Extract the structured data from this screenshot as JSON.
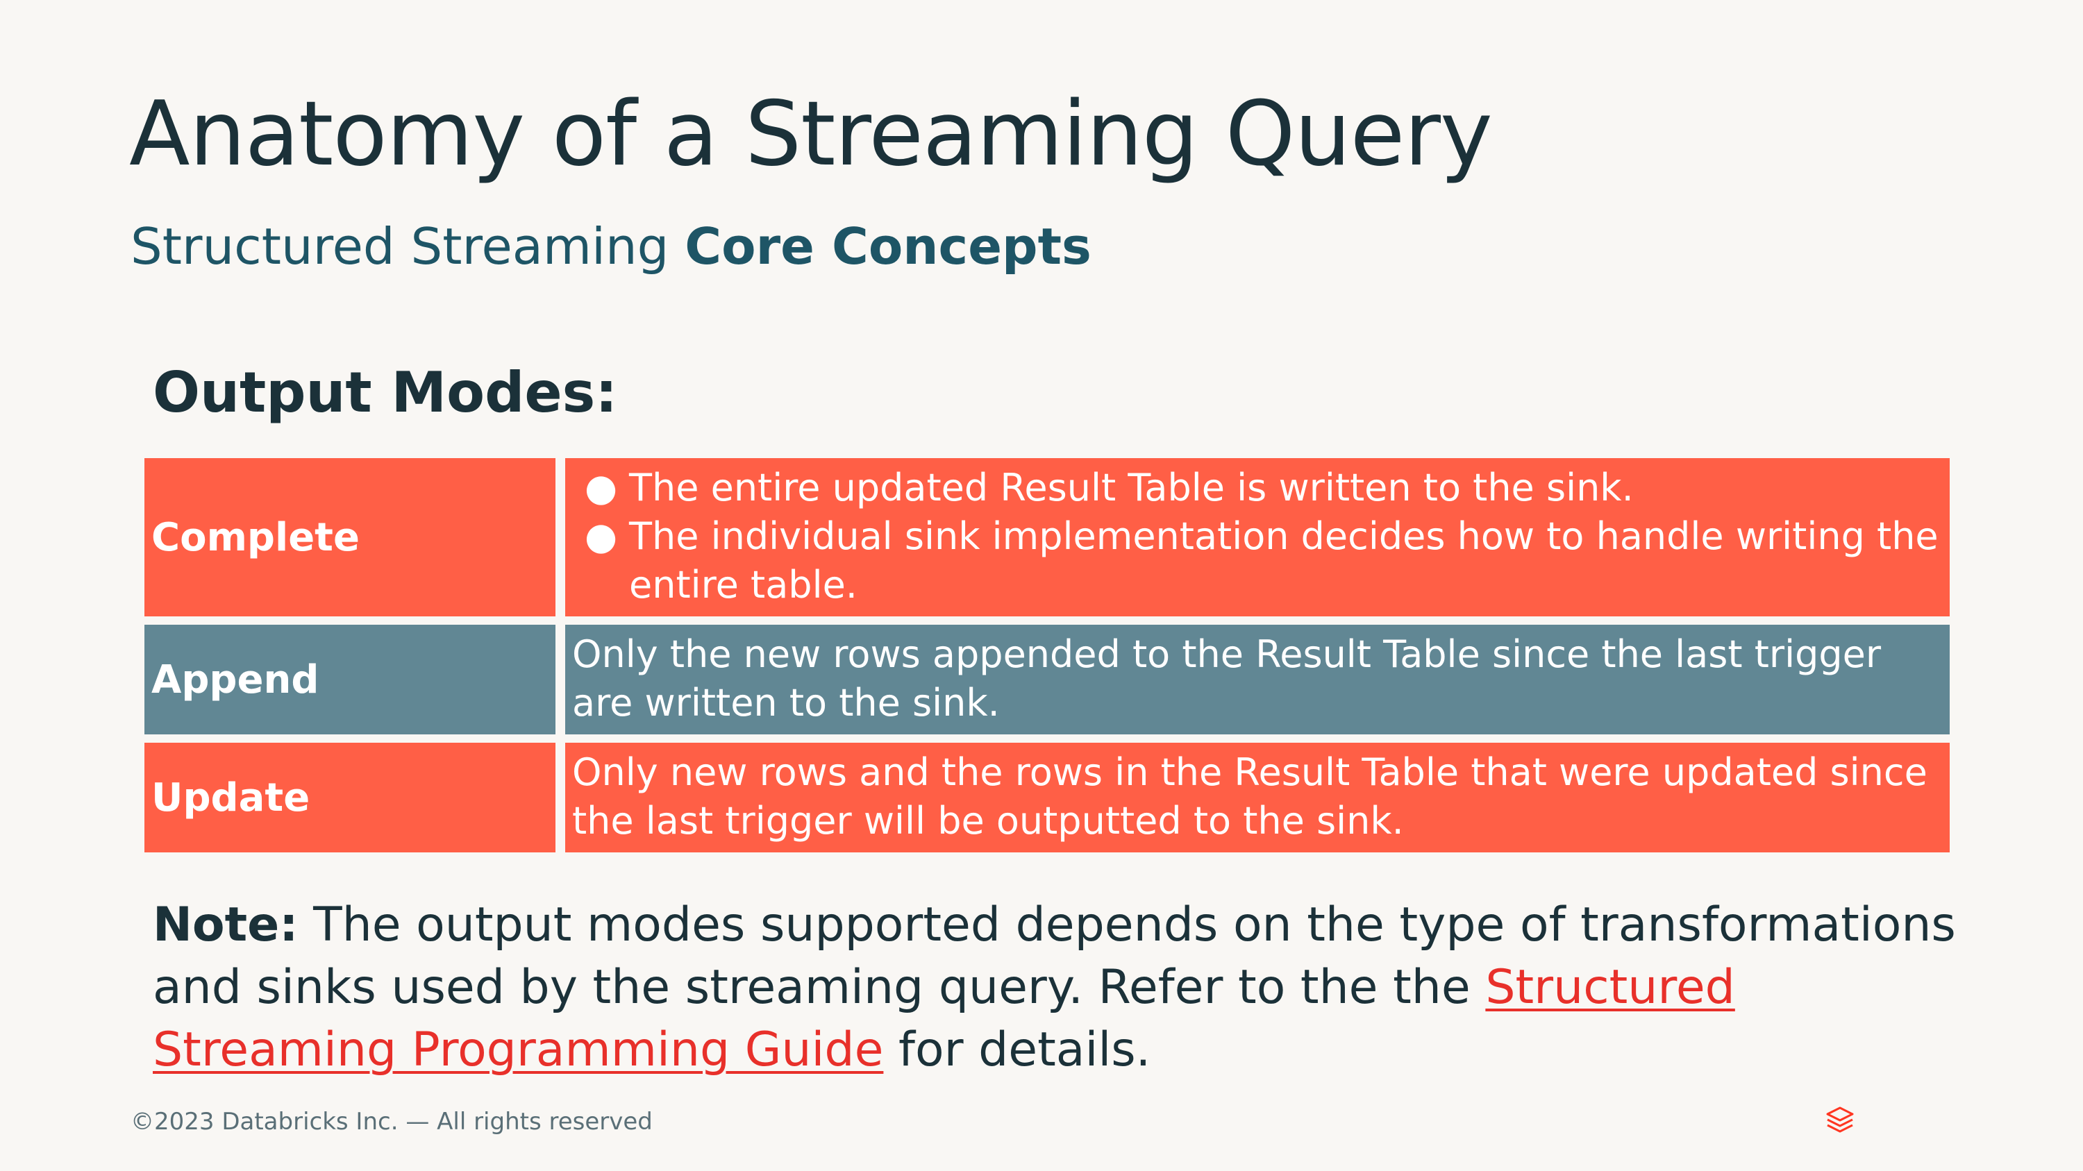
{
  "slide": {
    "title": "Anatomy of a Streaming Query",
    "subtitle_regular": "Structured Streaming ",
    "subtitle_bold": "Core Concepts",
    "section_heading": "Output Modes:"
  },
  "modes": [
    {
      "name": "Complete",
      "bullets": [
        "The entire updated Result Table is written to the sink.",
        "The individual sink implementation decides how to handle writing the entire table."
      ]
    },
    {
      "name": "Append",
      "text": "Only the new rows appended to the Result Table since the last trigger are written to the sink."
    },
    {
      "name": "Update",
      "text": "Only new rows and the rows in the Result Table that were updated since the last trigger will be outputted to the sink."
    }
  ],
  "note": {
    "label": "Note:",
    "text_before": " The output modes supported depends on the type of transformations and sinks used by the streaming query. Refer to the the ",
    "link_text": "Structured Streaming Programming Guide",
    "text_after": " for details."
  },
  "footer": {
    "copyright": "©2023 Databricks Inc. — All rights reserved",
    "logo_icon": "databricks-logo-icon"
  },
  "colors": {
    "background": "#F9F7F4",
    "title": "#1B3139",
    "subtitle": "#1E5566",
    "orange_row": "#FF5F46",
    "teal_row": "#618794",
    "link": "#E8302A"
  }
}
